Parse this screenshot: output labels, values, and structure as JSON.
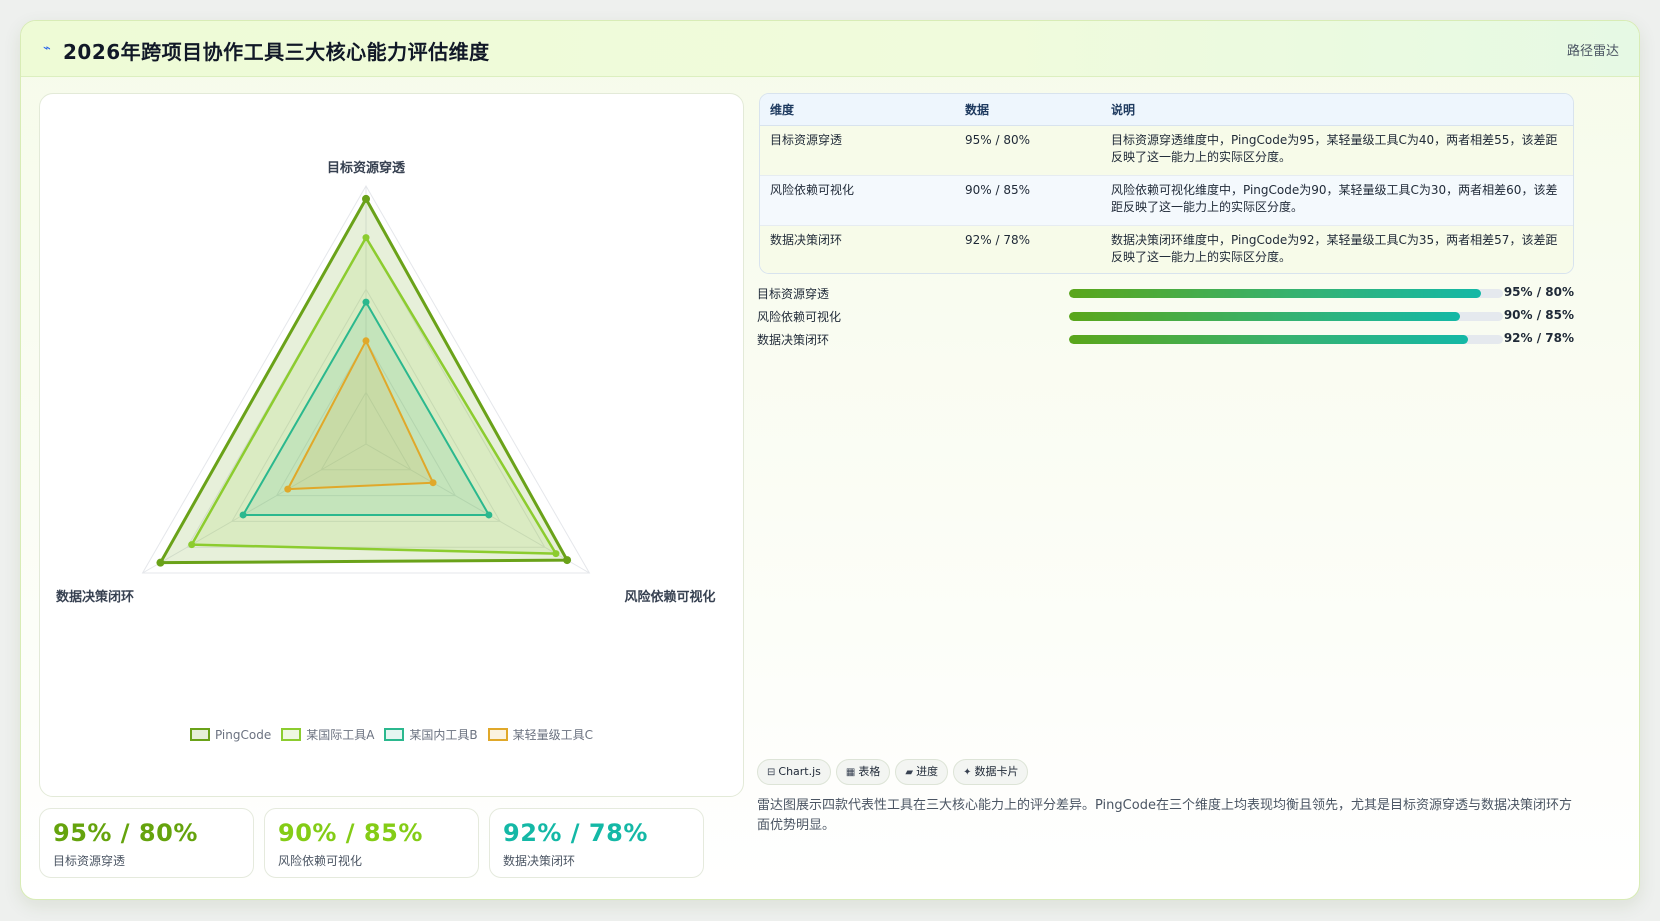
{
  "header": {
    "icon": "radar-icon",
    "title": "2026年跨项目协作工具三大核心能力评估维度",
    "tag": "路径雷达"
  },
  "colors": {
    "pingcode": "#6aa219",
    "toolA": "#8ccc2f",
    "toolB": "#2bb88e",
    "toolC": "#e0a82a"
  },
  "chart_data": {
    "type": "radar",
    "axes": [
      "目标资源穿透",
      "风险依赖可视化",
      "数据决策闭环"
    ],
    "range": [
      0,
      100
    ],
    "series": [
      {
        "name": "PingCode",
        "values": [
          95,
          90,
          92
        ]
      },
      {
        "name": "某国际工具A",
        "values": [
          80,
          85,
          78
        ]
      },
      {
        "name": "某国内工具B",
        "values": [
          55,
          55,
          55
        ]
      },
      {
        "name": "某轻量级工具C",
        "values": [
          40,
          30,
          35
        ]
      }
    ]
  },
  "stats": [
    {
      "value": "95% / 80%",
      "label": "目标资源穿透",
      "color": "#65a30d"
    },
    {
      "value": "90% / 85%",
      "label": "风险依赖可视化",
      "color": "#84cc16"
    },
    {
      "value": "92% / 78%",
      "label": "数据决策闭环",
      "color": "#14b8a6"
    }
  ],
  "table": {
    "headers": [
      "维度",
      "数据",
      "说明"
    ],
    "rows": [
      {
        "dim": "目标资源穿透",
        "data": "95% / 80%",
        "desc": "目标资源穿透维度中，PingCode为95，某轻量级工具C为40，两者相差55，该差距反映了这一能力上的实际区分度。"
      },
      {
        "dim": "风险依赖可视化",
        "data": "90% / 85%",
        "desc": "风险依赖可视化维度中，PingCode为90，某轻量级工具C为30，两者相差60，该差距反映了这一能力上的实际区分度。"
      },
      {
        "dim": "数据决策闭环",
        "data": "92% / 78%",
        "desc": "数据决策闭环维度中，PingCode为92，某轻量级工具C为35，两者相差57，该差距反映了这一能力上的实际区分度。"
      }
    ]
  },
  "progress": [
    {
      "label": "目标资源穿透",
      "percent": 95,
      "value": "95% / 80%"
    },
    {
      "label": "风险依赖可视化",
      "percent": 90,
      "value": "90% / 85%"
    },
    {
      "label": "数据决策闭环",
      "percent": 92,
      "value": "92% / 78%"
    }
  ],
  "chips": [
    {
      "icon": "⊟",
      "label": "Chart.js"
    },
    {
      "icon": "▦",
      "label": "表格"
    },
    {
      "icon": "▰",
      "label": "进度"
    },
    {
      "icon": "✦",
      "label": "数据卡片"
    }
  ],
  "summary": "雷达图展示四款代表性工具在三大核心能力上的评分差异。PingCode在三个维度上均表现均衡且领先，尤其是目标资源穿透与数据决策闭环方面优势明显。"
}
